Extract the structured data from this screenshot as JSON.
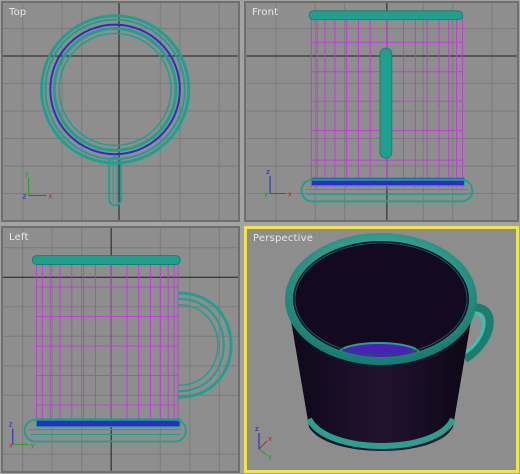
{
  "viewports": {
    "top": {
      "label": "Top"
    },
    "front": {
      "label": "Front"
    },
    "left": {
      "label": "Left"
    },
    "perspective": {
      "label": "Perspective"
    }
  },
  "axis_gizmo": {
    "top": [
      "x",
      "y",
      "z"
    ],
    "front": [
      "x",
      "y",
      "z"
    ],
    "left": [
      "x",
      "y",
      "z"
    ],
    "perspective": [
      "x",
      "y",
      "z"
    ]
  },
  "colors": {
    "viewport_bg": "#8e8e8e",
    "grid": "#7b7b7b",
    "axis_grid": "#202020",
    "teal_wire": "#1fa08e",
    "purple_wire": "#c13cd7",
    "blue_wire": "#2c2cc8",
    "active_border": "#f2e34c",
    "teal_shaded": "#2aa08f",
    "interior_dark": "#1a0d28"
  }
}
